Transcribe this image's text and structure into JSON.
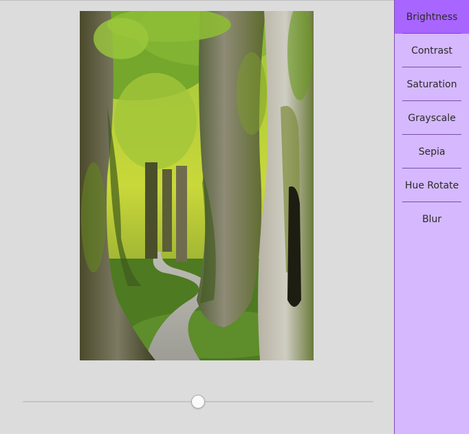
{
  "filters": {
    "active_index": 0,
    "items": [
      {
        "label": "Brightness"
      },
      {
        "label": "Contrast"
      },
      {
        "label": "Saturation"
      },
      {
        "label": "Grayscale"
      },
      {
        "label": "Sepia"
      },
      {
        "label": "Hue Rotate"
      },
      {
        "label": "Blur"
      }
    ]
  },
  "slider": {
    "value_fraction": 0.5
  },
  "colors": {
    "sidebar_bg": "#d5b8fd",
    "active_item_bg": "#a865ff",
    "separator": "#7a4bb0",
    "canvas_bg": "#dcdcdc"
  },
  "image": {
    "subject": "tree-lined gravel path through mossy forest"
  }
}
